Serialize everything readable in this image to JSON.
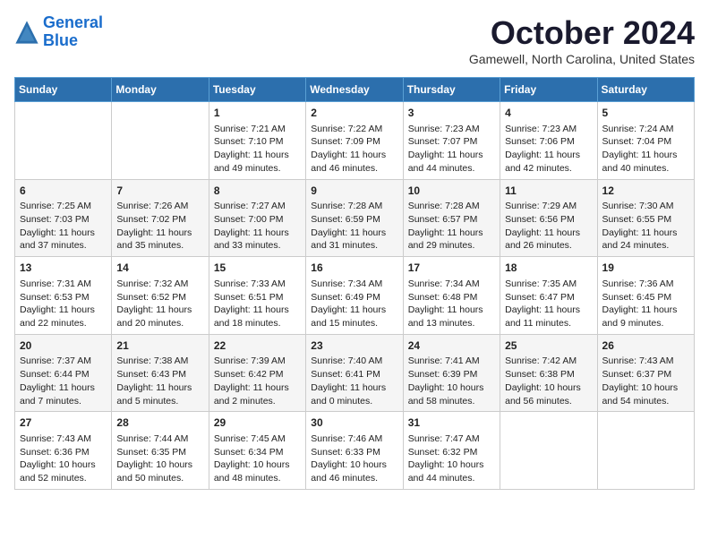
{
  "logo": {
    "line1": "General",
    "line2": "Blue"
  },
  "title": "October 2024",
  "subtitle": "Gamewell, North Carolina, United States",
  "headers": [
    "Sunday",
    "Monday",
    "Tuesday",
    "Wednesday",
    "Thursday",
    "Friday",
    "Saturday"
  ],
  "weeks": [
    [
      {
        "day": "",
        "info": ""
      },
      {
        "day": "",
        "info": ""
      },
      {
        "day": "1",
        "info": "Sunrise: 7:21 AM\nSunset: 7:10 PM\nDaylight: 11 hours and 49 minutes."
      },
      {
        "day": "2",
        "info": "Sunrise: 7:22 AM\nSunset: 7:09 PM\nDaylight: 11 hours and 46 minutes."
      },
      {
        "day": "3",
        "info": "Sunrise: 7:23 AM\nSunset: 7:07 PM\nDaylight: 11 hours and 44 minutes."
      },
      {
        "day": "4",
        "info": "Sunrise: 7:23 AM\nSunset: 7:06 PM\nDaylight: 11 hours and 42 minutes."
      },
      {
        "day": "5",
        "info": "Sunrise: 7:24 AM\nSunset: 7:04 PM\nDaylight: 11 hours and 40 minutes."
      }
    ],
    [
      {
        "day": "6",
        "info": "Sunrise: 7:25 AM\nSunset: 7:03 PM\nDaylight: 11 hours and 37 minutes."
      },
      {
        "day": "7",
        "info": "Sunrise: 7:26 AM\nSunset: 7:02 PM\nDaylight: 11 hours and 35 minutes."
      },
      {
        "day": "8",
        "info": "Sunrise: 7:27 AM\nSunset: 7:00 PM\nDaylight: 11 hours and 33 minutes."
      },
      {
        "day": "9",
        "info": "Sunrise: 7:28 AM\nSunset: 6:59 PM\nDaylight: 11 hours and 31 minutes."
      },
      {
        "day": "10",
        "info": "Sunrise: 7:28 AM\nSunset: 6:57 PM\nDaylight: 11 hours and 29 minutes."
      },
      {
        "day": "11",
        "info": "Sunrise: 7:29 AM\nSunset: 6:56 PM\nDaylight: 11 hours and 26 minutes."
      },
      {
        "day": "12",
        "info": "Sunrise: 7:30 AM\nSunset: 6:55 PM\nDaylight: 11 hours and 24 minutes."
      }
    ],
    [
      {
        "day": "13",
        "info": "Sunrise: 7:31 AM\nSunset: 6:53 PM\nDaylight: 11 hours and 22 minutes."
      },
      {
        "day": "14",
        "info": "Sunrise: 7:32 AM\nSunset: 6:52 PM\nDaylight: 11 hours and 20 minutes."
      },
      {
        "day": "15",
        "info": "Sunrise: 7:33 AM\nSunset: 6:51 PM\nDaylight: 11 hours and 18 minutes."
      },
      {
        "day": "16",
        "info": "Sunrise: 7:34 AM\nSunset: 6:49 PM\nDaylight: 11 hours and 15 minutes."
      },
      {
        "day": "17",
        "info": "Sunrise: 7:34 AM\nSunset: 6:48 PM\nDaylight: 11 hours and 13 minutes."
      },
      {
        "day": "18",
        "info": "Sunrise: 7:35 AM\nSunset: 6:47 PM\nDaylight: 11 hours and 11 minutes."
      },
      {
        "day": "19",
        "info": "Sunrise: 7:36 AM\nSunset: 6:45 PM\nDaylight: 11 hours and 9 minutes."
      }
    ],
    [
      {
        "day": "20",
        "info": "Sunrise: 7:37 AM\nSunset: 6:44 PM\nDaylight: 11 hours and 7 minutes."
      },
      {
        "day": "21",
        "info": "Sunrise: 7:38 AM\nSunset: 6:43 PM\nDaylight: 11 hours and 5 minutes."
      },
      {
        "day": "22",
        "info": "Sunrise: 7:39 AM\nSunset: 6:42 PM\nDaylight: 11 hours and 2 minutes."
      },
      {
        "day": "23",
        "info": "Sunrise: 7:40 AM\nSunset: 6:41 PM\nDaylight: 11 hours and 0 minutes."
      },
      {
        "day": "24",
        "info": "Sunrise: 7:41 AM\nSunset: 6:39 PM\nDaylight: 10 hours and 58 minutes."
      },
      {
        "day": "25",
        "info": "Sunrise: 7:42 AM\nSunset: 6:38 PM\nDaylight: 10 hours and 56 minutes."
      },
      {
        "day": "26",
        "info": "Sunrise: 7:43 AM\nSunset: 6:37 PM\nDaylight: 10 hours and 54 minutes."
      }
    ],
    [
      {
        "day": "27",
        "info": "Sunrise: 7:43 AM\nSunset: 6:36 PM\nDaylight: 10 hours and 52 minutes."
      },
      {
        "day": "28",
        "info": "Sunrise: 7:44 AM\nSunset: 6:35 PM\nDaylight: 10 hours and 50 minutes."
      },
      {
        "day": "29",
        "info": "Sunrise: 7:45 AM\nSunset: 6:34 PM\nDaylight: 10 hours and 48 minutes."
      },
      {
        "day": "30",
        "info": "Sunrise: 7:46 AM\nSunset: 6:33 PM\nDaylight: 10 hours and 46 minutes."
      },
      {
        "day": "31",
        "info": "Sunrise: 7:47 AM\nSunset: 6:32 PM\nDaylight: 10 hours and 44 minutes."
      },
      {
        "day": "",
        "info": ""
      },
      {
        "day": "",
        "info": ""
      }
    ]
  ]
}
